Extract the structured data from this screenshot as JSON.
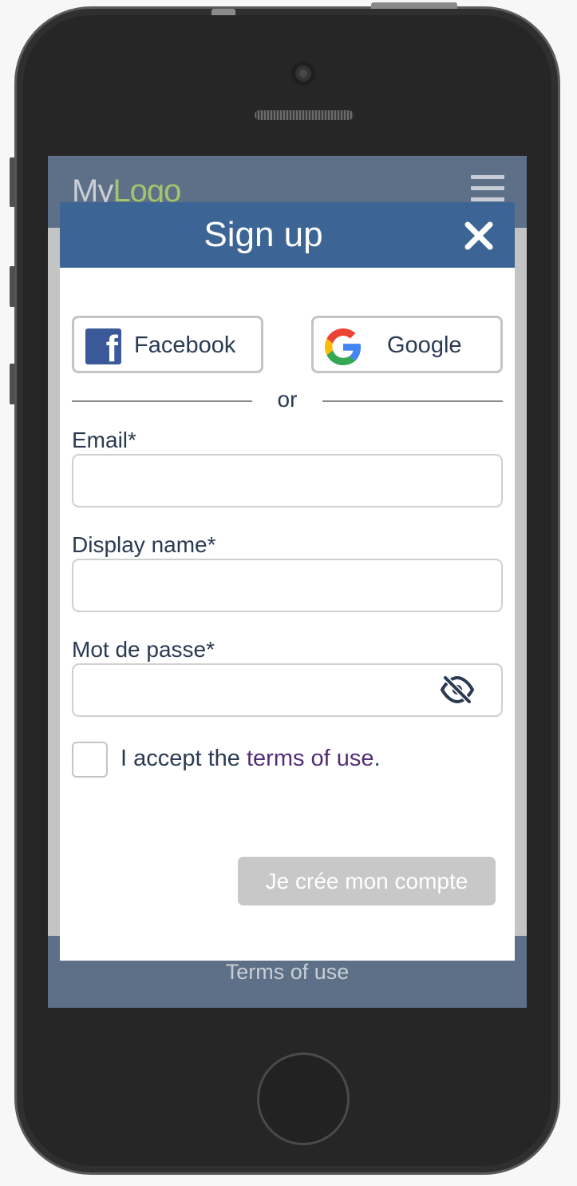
{
  "app": {
    "logo_my": "My",
    "logo_logo": "Logo",
    "footer_link": "Terms of use"
  },
  "modal": {
    "title": "Sign up",
    "social": {
      "facebook_label": "Facebook",
      "google_label": "Google"
    },
    "divider_text": "or",
    "fields": {
      "email_label": "Email*",
      "email_value": "",
      "display_name_label": "Display name*",
      "display_name_value": "",
      "password_label": "Mot de passe*",
      "password_value": ""
    },
    "terms": {
      "checked": false,
      "prefix": "I accept the ",
      "link": "terms of use",
      "suffix": "."
    },
    "submit_label": "Je crée mon compte"
  },
  "colors": {
    "header_bar": "#5d7087",
    "modal_header": "#3c6595",
    "logo_accent": "#a3c46b",
    "terms_link": "#532c79",
    "submit_disabled": "#c8c8c8"
  },
  "icons": {
    "close": "close-icon",
    "menu": "hamburger-menu-icon",
    "facebook": "facebook-icon",
    "google": "google-icon",
    "password_visibility": "eye-slash-icon"
  }
}
